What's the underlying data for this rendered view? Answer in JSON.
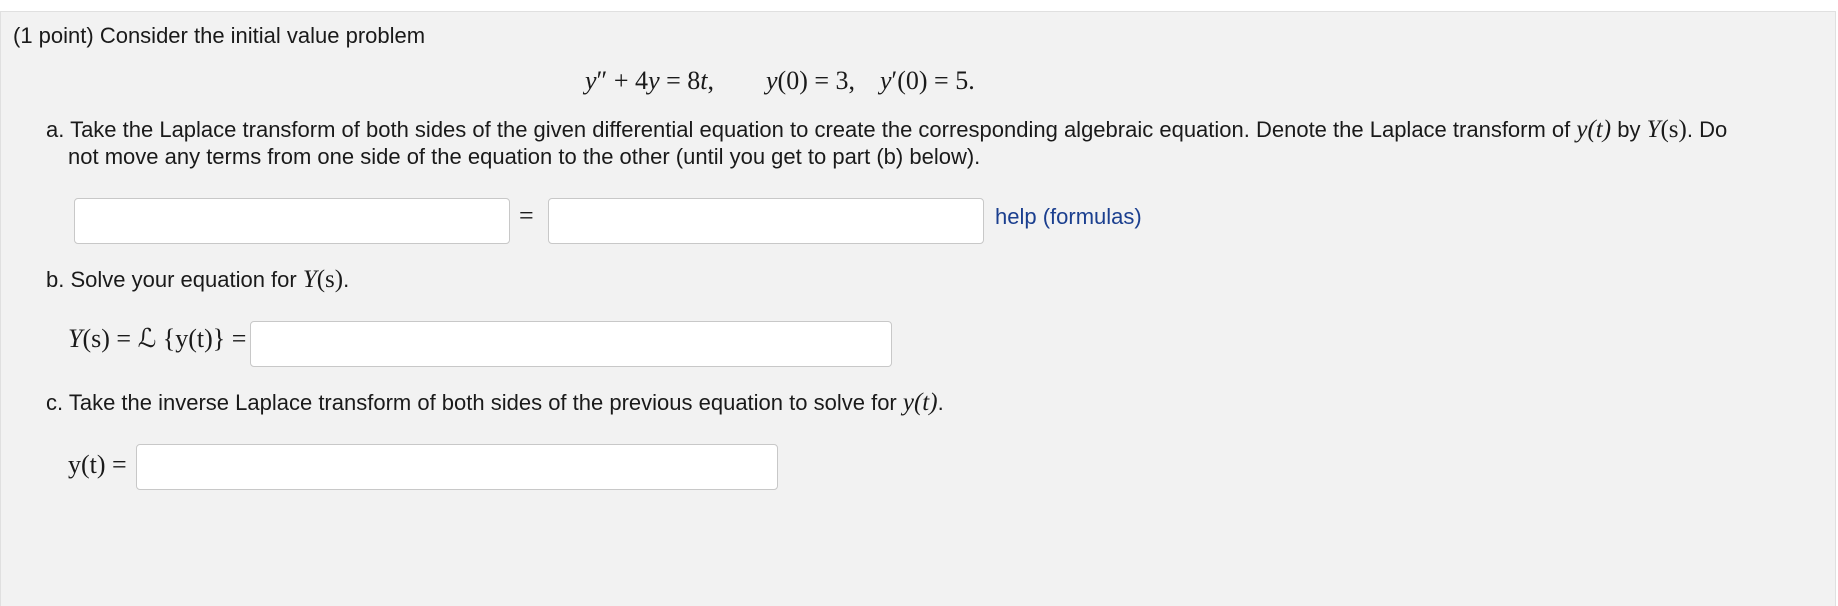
{
  "intro": "(1 point) Consider the initial value problem",
  "ode": {
    "lhs_y": "y",
    "lhs_primes": "″",
    "plus_4": "+ 4",
    "y2": "y",
    "equals_8": "= 8",
    "t": "t",
    "comma": ",",
    "ic1_y": "y",
    "ic1_rest": "(0) = 3,",
    "ic2_y": "y",
    "ic2_prime": "′",
    "ic2_rest": "(0) = 5."
  },
  "part_a": {
    "line1_start": "a. Take the Laplace transform of both sides of the given differential equation to create the corresponding algebraic equation. Denote the Laplace transform of ",
    "y_t": "y(t)",
    "by": " by ",
    "Y_s": "Y",
    "Y_s_paren": "(s)",
    "line1_end": ". Do",
    "line2": "not move any terms from one side of the equation to the other (until you get to part (b) below).",
    "equals": "=",
    "help_link": "help (formulas)",
    "input_left_value": "",
    "input_right_value": ""
  },
  "part_b": {
    "text": "b. Solve your equation for ",
    "Y": "Y",
    "Y_paren": "(s)",
    "period": ".",
    "label_Y": "Y",
    "label_rest": "(s) = ℒ {y(t)} =",
    "input_value": ""
  },
  "part_c": {
    "text": "c. Take the inverse Laplace transform of both sides of the previous equation to solve for ",
    "y_t": "y(t)",
    "period": ".",
    "label": "y(t) =",
    "input_value": ""
  }
}
